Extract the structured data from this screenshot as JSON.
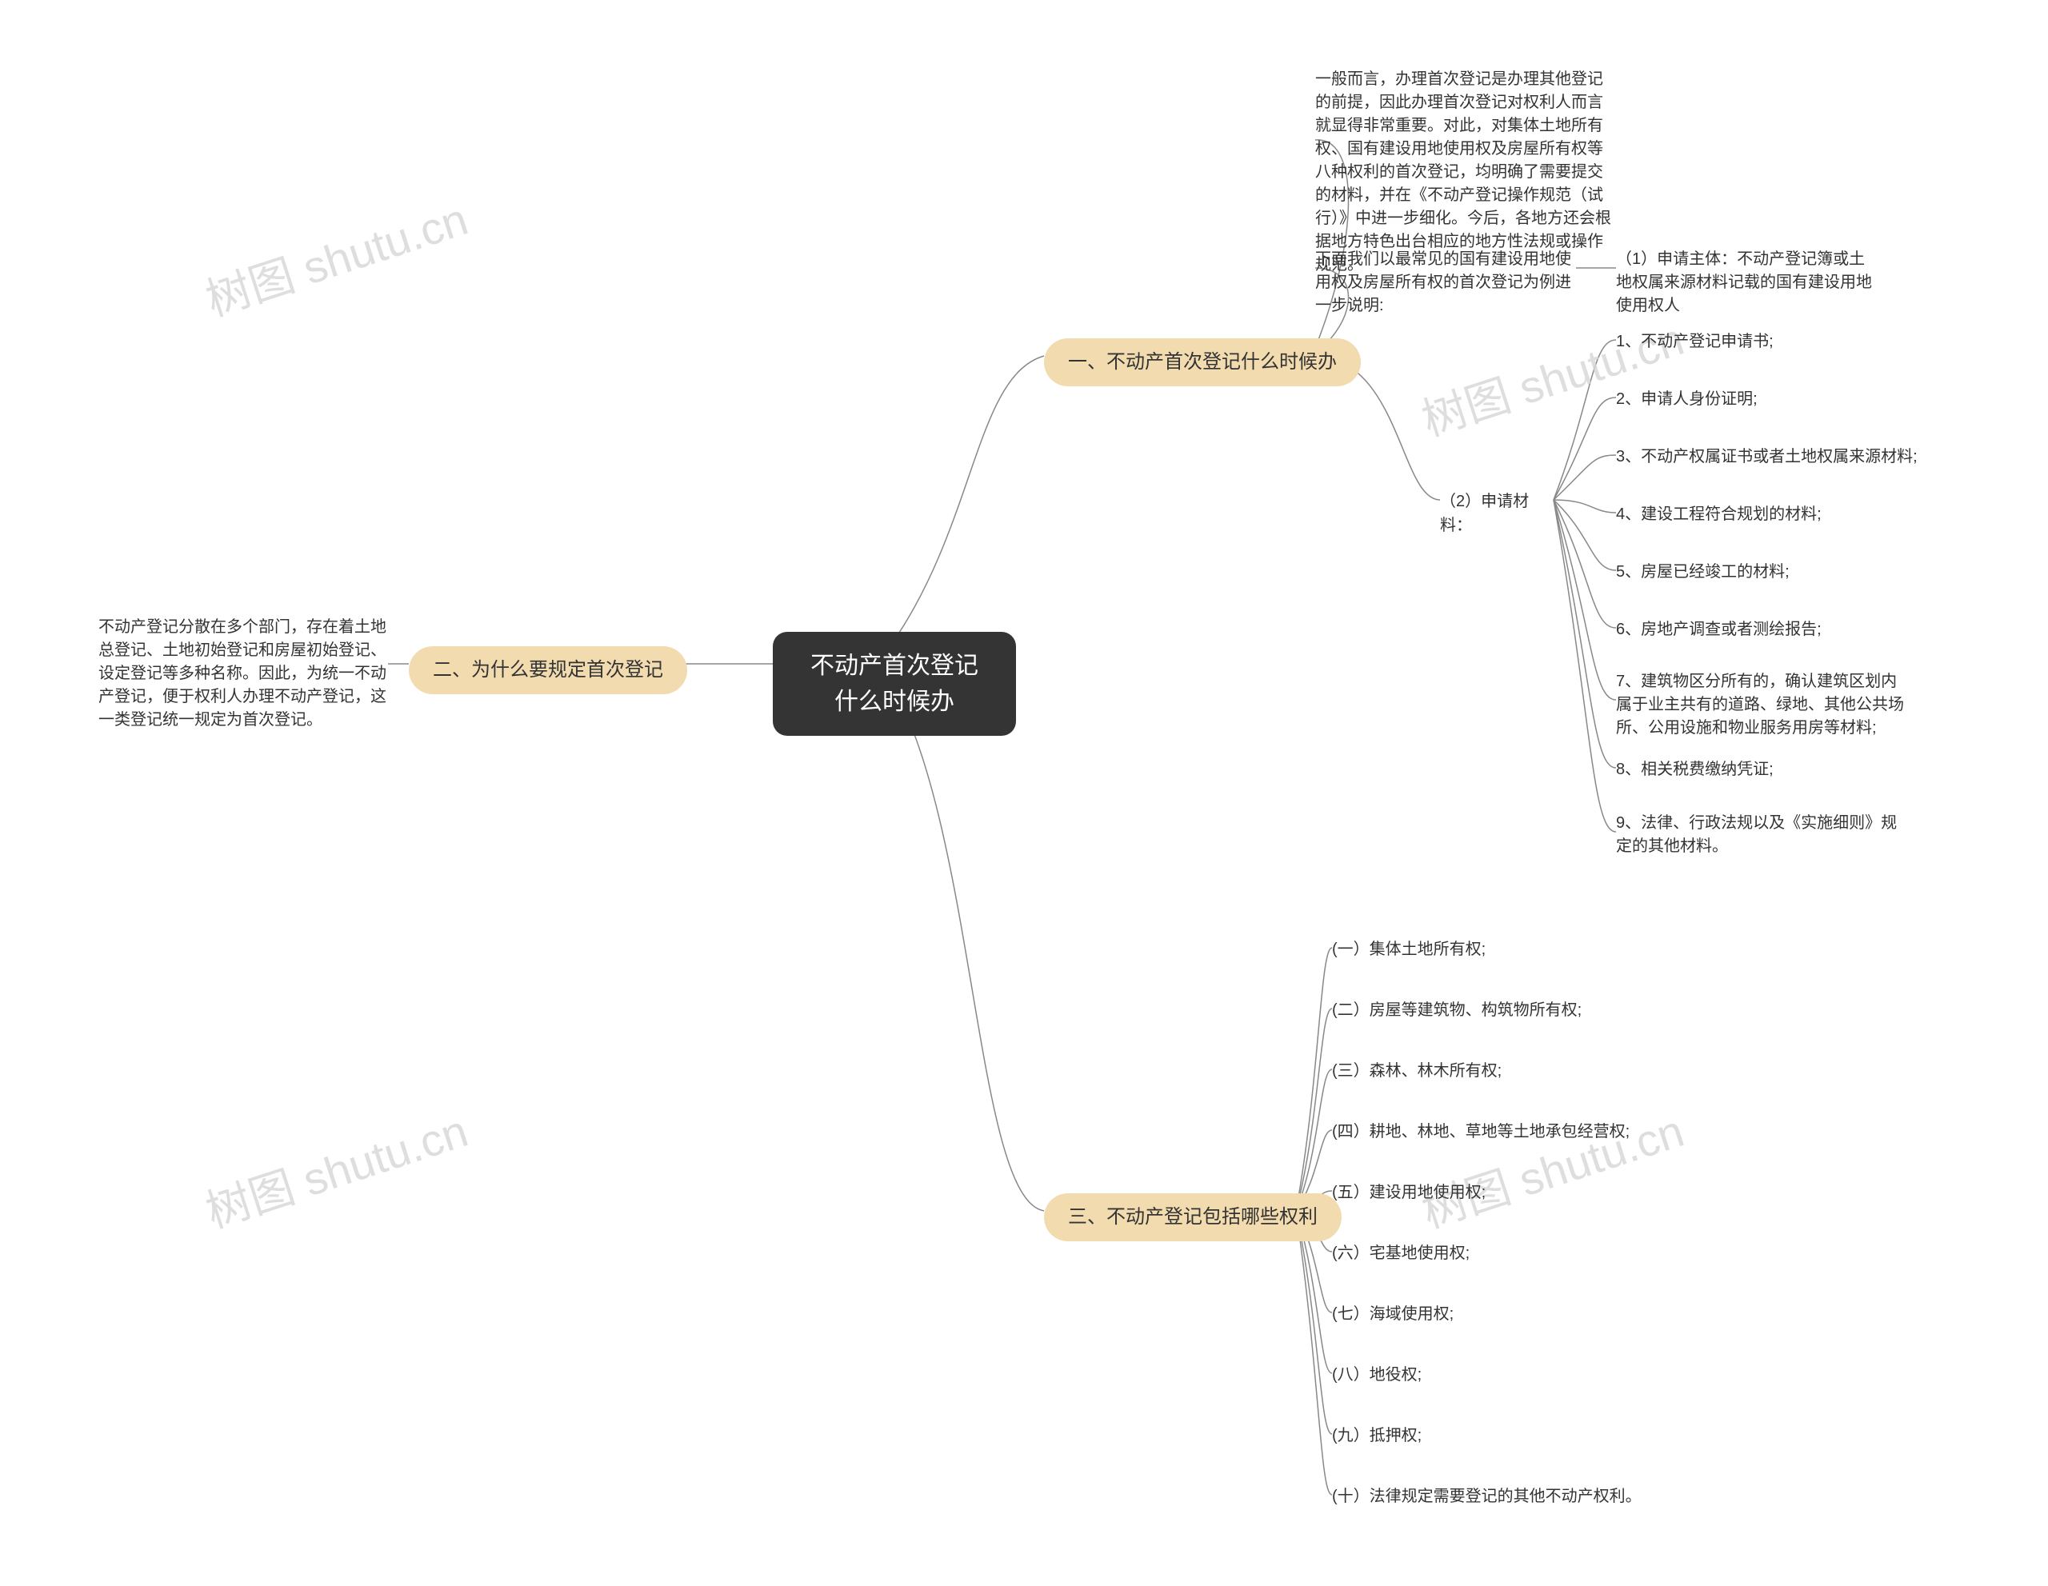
{
  "root": {
    "title": "不动产首次登记什么时候办"
  },
  "branches": {
    "b1": {
      "label": "一、不动产首次登记什么时候办"
    },
    "b2": {
      "label": "二、为什么要规定首次登记"
    },
    "b3": {
      "label": "三、不动产登记包括哪些权利"
    }
  },
  "b1_c1": "一般而言，办理首次登记是办理其他登记的前提，因此办理首次登记对权利人而言就显得非常重要。对此，对集体土地所有权、国有建设用地使用权及房屋所有权等八种权利的首次登记，均明确了需要提交的材料，并在《不动产登记操作规范（试行）》中进一步细化。今后，各地方还会根据地方特色出台相应的地方性法规或操作规范。",
  "b1_c2": "下面我们以最常见的国有建设用地使用权及房屋所有权的首次登记为例进一步说明:",
  "b1_c2_1": "（1）申请主体：不动产登记簿或土地权属来源材料记载的国有建设用地使用权人",
  "b1_c3": "（2）申请材料：",
  "b1_c3_items": [
    "1、不动产登记申请书;",
    "2、申请人身份证明;",
    "3、不动产权属证书或者土地权属来源材料;",
    "4、建设工程符合规划的材料;",
    "5、房屋已经竣工的材料;",
    "6、房地产调查或者测绘报告;",
    "7、建筑物区分所有的，确认建筑区划内属于业主共有的道路、绿地、其他公共场所、公用设施和物业服务用房等材料;",
    "8、相关税费缴纳凭证;",
    "9、法律、行政法规以及《实施细则》规定的其他材料。"
  ],
  "b2_c1": "不动产登记分散在多个部门，存在着土地总登记、土地初始登记和房屋初始登记、设定登记等多种名称。因此，为统一不动产登记，便于权利人办理不动产登记，这一类登记统一规定为首次登记。",
  "b3_items": [
    "(一）集体土地所有权;",
    "(二）房屋等建筑物、构筑物所有权;",
    "(三）森林、林木所有权;",
    "(四）耕地、林地、草地等土地承包经营权;",
    "(五）建设用地使用权;",
    "(六）宅基地使用权;",
    "(七）海域使用权;",
    "(八）地役权;",
    "(九）抵押权;",
    "(十）法律规定需要登记的其他不动产权利。"
  ],
  "watermark": "树图 shutu.cn"
}
